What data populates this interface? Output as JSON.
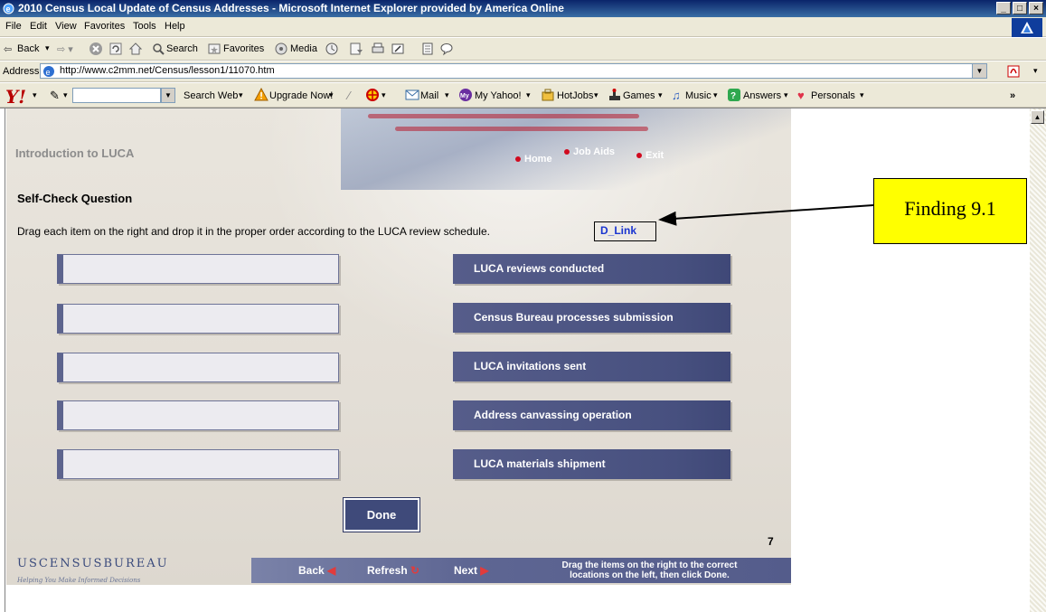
{
  "window": {
    "title": "2010 Census Local Update of Census Addresses - Microsoft Internet Explorer provided by America Online",
    "controls": [
      "_",
      "□",
      "×"
    ]
  },
  "menubar": {
    "items": [
      "File",
      "Edit",
      "View",
      "Favorites",
      "Tools",
      "Help"
    ]
  },
  "toolbar": {
    "back": "Back",
    "search": "Search",
    "favorites": "Favorites",
    "media": "Media"
  },
  "address_bar": {
    "label": "Address",
    "url": "http://www.c2mm.net/Census/lesson1/11070.htm"
  },
  "yahoo_toolbar": {
    "search_web": "Search Web",
    "upgrade": "Upgrade Now!",
    "mail": "Mail",
    "my_yahoo": "My Yahoo!",
    "hotjobs": "HotJobs",
    "games": "Games",
    "music": "Music",
    "answers": "Answers",
    "personals": "Personals",
    "more": "»"
  },
  "lesson": {
    "course_title": "Introduction to LUCA",
    "nav": {
      "home": "Home",
      "job_aids": "Job Aids",
      "exit": "Exit"
    },
    "question_title": "Self-Check Question",
    "instructions": "Drag each item on the right and drop it in the proper order according to the LUCA review schedule.",
    "d_link": "D_Link",
    "drag_items": [
      "LUCA reviews conducted",
      "Census Bureau processes submission",
      "LUCA invitations sent",
      "Address canvassing operation",
      "LUCA materials shipment"
    ],
    "done_label": "Done",
    "page_number": "7",
    "footer": {
      "logo": "USCENSUSBUREAU",
      "tagline": "Helping You Make Informed Decisions",
      "back": "Back",
      "refresh": "Refresh",
      "next": "Next",
      "hint_line1": "Drag the items on the right to the correct",
      "hint_line2": "locations on the left, then click Done."
    }
  },
  "annotation": {
    "label": "Finding 9.1"
  },
  "colors": {
    "title_bar": "#0a246a",
    "item_bg": "#4b5383",
    "callout": "#ffff00",
    "link": "#1a35d0"
  }
}
